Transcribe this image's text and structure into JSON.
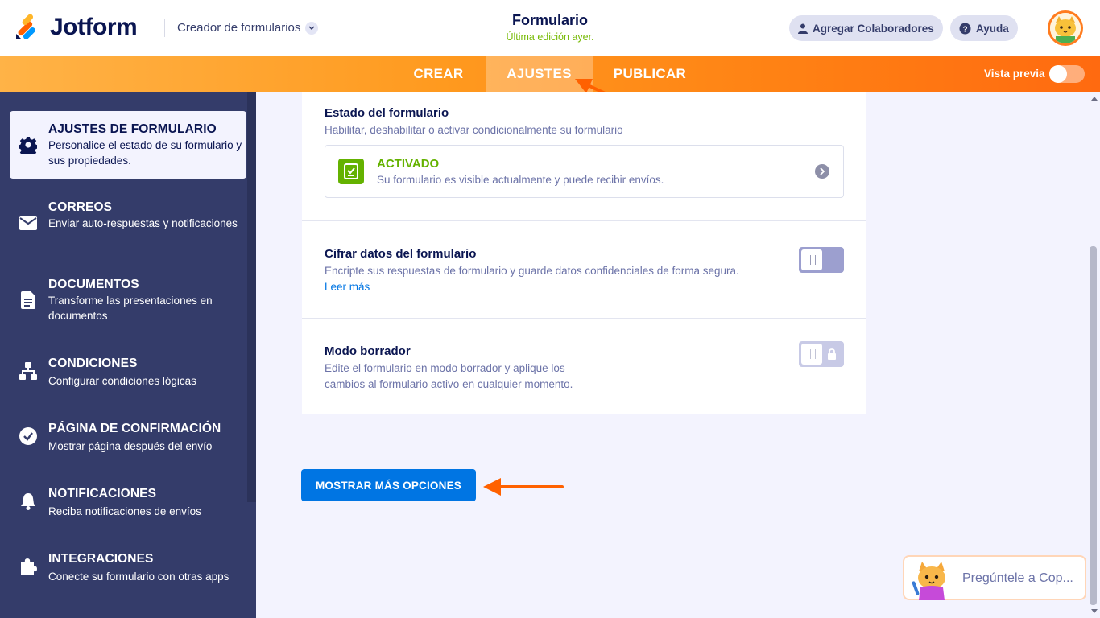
{
  "header": {
    "logo_text": "Jotform",
    "builder_label": "Creador de formularios",
    "form_title": "Formulario",
    "form_subtitle": "Última edición ayer.",
    "collaborators_label": "Agregar Colaboradores",
    "help_label": "Ayuda"
  },
  "navbar": {
    "tabs": [
      {
        "label": "CREAR",
        "active": false
      },
      {
        "label": "AJUSTES",
        "active": true
      },
      {
        "label": "PUBLICAR",
        "active": false
      }
    ],
    "preview_label": "Vista previa",
    "preview_on": false
  },
  "sidebar": {
    "items": [
      {
        "title": "AJUSTES DE FORMULARIO",
        "desc": "Personalice el estado de su formulario y sus propiedades.",
        "icon": "gear-icon",
        "active": true
      },
      {
        "title": "CORREOS",
        "desc": "Enviar auto-respuestas y notificaciones",
        "icon": "envelope-icon",
        "active": false
      },
      {
        "title": "DOCUMENTOS",
        "desc": "Transforme las presentaciones en documentos",
        "icon": "document-icon",
        "active": false
      },
      {
        "title": "CONDICIONES",
        "desc": "Configurar condiciones lógicas",
        "icon": "sitemap-icon",
        "active": false
      },
      {
        "title": "PÁGINA DE CONFIRMACIÓN",
        "desc": "Mostrar página después del envío",
        "icon": "check-circle-icon",
        "active": false
      },
      {
        "title": "NOTIFICACIONES",
        "desc": "Reciba notificaciones de envíos",
        "icon": "bell-icon",
        "active": false
      },
      {
        "title": "INTEGRACIONES",
        "desc": "Conecte su formulario con otras apps",
        "icon": "puzzle-icon",
        "active": false
      }
    ]
  },
  "main": {
    "status": {
      "title": "Estado del formulario",
      "desc": "Habilitar, deshabilitar o activar condicionalmente su formulario",
      "value": "ACTIVADO",
      "value_desc": "Su formulario es visible actualmente y puede recibir envíos."
    },
    "encrypt": {
      "title": "Cifrar datos del formulario",
      "desc": "Encripte sus respuestas de formulario y guarde datos confidenciales de forma segura.",
      "link": "Leer más",
      "enabled": false
    },
    "draft": {
      "title": "Modo borrador",
      "desc_line1": "Edite el formulario en modo borrador y aplique los",
      "desc_line2": "cambios al formulario activo en cualquier momento.",
      "enabled": false,
      "locked": true
    },
    "more_button": "MOSTRAR MÁS OPCIONES"
  },
  "copilot": {
    "label": "Pregúntele a Cop..."
  },
  "colors": {
    "navy": "#0a1551",
    "sidebar": "#343c6a",
    "orange": "#ff6100",
    "blue": "#0075e3",
    "green": "#64b200"
  }
}
